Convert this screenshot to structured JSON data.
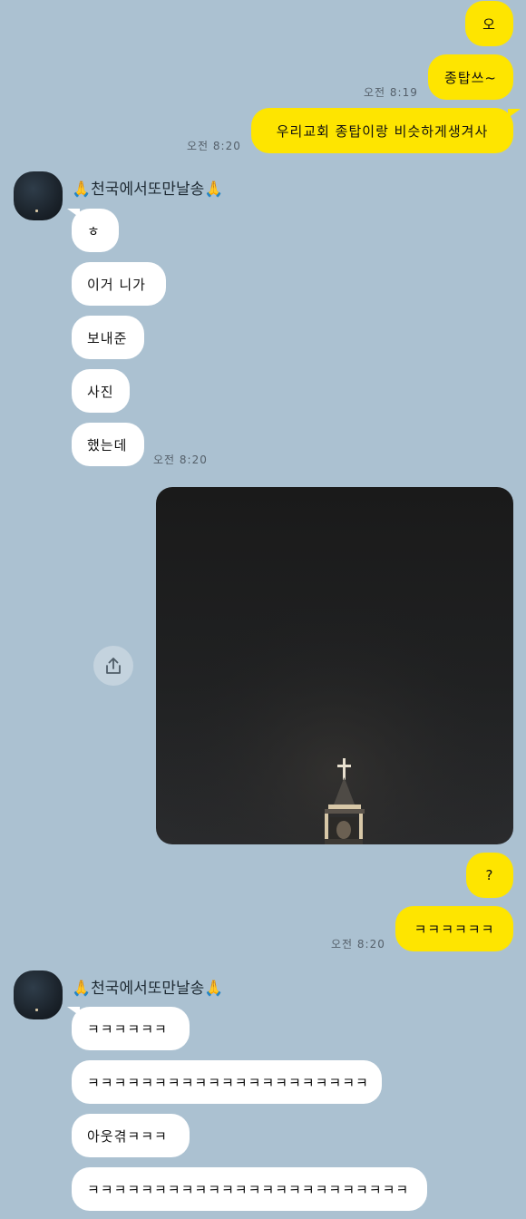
{
  "messages": [
    {
      "side": "me",
      "text": "오"
    },
    {
      "side": "me",
      "text": "종탑쓰~"
    },
    {
      "side": "me",
      "text": "우리교회 종탑이랑 비슷하게생겨사"
    },
    {
      "side": "them",
      "text": "ㅎ"
    },
    {
      "side": "them",
      "text": "이거 니가"
    },
    {
      "side": "them",
      "text": "보내준"
    },
    {
      "side": "them",
      "text": "사진"
    },
    {
      "side": "them",
      "text": "했는데"
    },
    {
      "side": "me",
      "text": "?"
    },
    {
      "side": "me",
      "text": "ㅋㅋㅋㅋㅋㅋ"
    },
    {
      "side": "them",
      "text": "ㅋㅋㅋㅋㅋㅋ"
    },
    {
      "side": "them",
      "text": "ㅋㅋㅋㅋㅋㅋㅋㅋㅋㅋㅋㅋㅋㅋㅋㅋㅋㅋㅋㅋㅋ"
    },
    {
      "side": "them",
      "text": "아웃겪ㅋㅋㅋ"
    },
    {
      "side": "them",
      "text": "ㅋㅋㅋㅋㅋㅋㅋㅋㅋㅋㅋㅋㅋㅋㅋㅋㅋㅋㅋㅋㅋㅋㅋㅋ"
    }
  ],
  "times": {
    "t1": "오전 8:19",
    "t2": "오전 8:20",
    "t3": "오전 8:20",
    "t4": "오전 8:20"
  },
  "sender": {
    "prefix": "🙏",
    "name": "천국에서또만날송",
    "suffix": "🙏"
  },
  "photo": {
    "subject": "church bell tower with cross at night"
  },
  "icons": {
    "share": "share-icon",
    "cross": "cross-icon"
  }
}
